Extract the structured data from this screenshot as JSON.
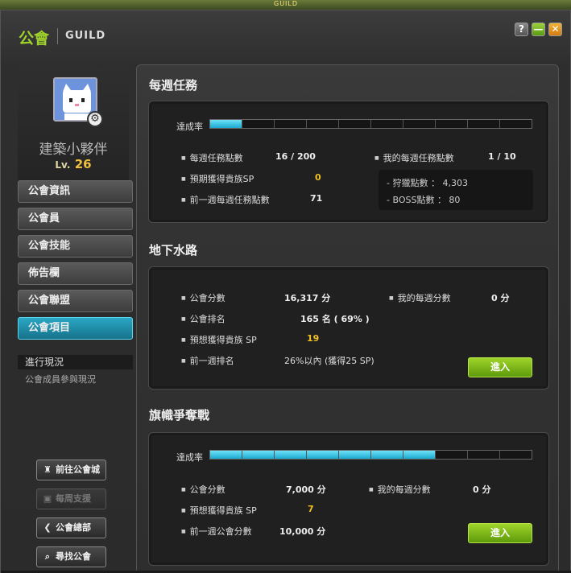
{
  "top_tag": "GUILD",
  "window": {
    "title_cn": "公會",
    "title_en": "GUILD",
    "help_label": "?",
    "min_label": "—",
    "close_label": "✕"
  },
  "profile": {
    "name": "建築小夥伴",
    "level_prefix": "Lv.",
    "level": "26"
  },
  "menu": [
    {
      "label": "公會資訊",
      "active": false
    },
    {
      "label": "公會員",
      "active": false
    },
    {
      "label": "公會技能",
      "active": false
    },
    {
      "label": "佈告欄",
      "active": false
    },
    {
      "label": "公會聯盟",
      "active": false
    },
    {
      "label": "公會項目",
      "active": true
    }
  ],
  "submenu": {
    "header": "進行現況",
    "item": "公會成員參與現況"
  },
  "side_buttons": [
    {
      "label": "前往公會城",
      "icon": "castle-icon",
      "enabled": true
    },
    {
      "label": "每周支援",
      "icon": "box-icon",
      "enabled": false
    },
    {
      "label": "公會總部",
      "icon": "back-arrow-icon",
      "enabled": true
    },
    {
      "label": "尋找公會",
      "icon": "search-icon",
      "enabled": true
    }
  ],
  "weekly": {
    "title": "每週任務",
    "progress_label": "達成率",
    "progress_segments": 10,
    "progress_filled": 1,
    "points_label": "每週任務點數",
    "points_value": "16 / 200",
    "my_points_label": "我的每週任務點數",
    "my_points_value": "1 / 10",
    "expected_sp_label": "預期獲得貴族SP",
    "expected_sp_value": "0",
    "last_week_label": "前一週每週任務點數",
    "last_week_value": "71",
    "hunting_label": "- 狩獵點數 ： 4,303",
    "boss_label": "- BOSS點數 ： 80"
  },
  "sewer": {
    "title": "地下水路",
    "score_label": "公會分數",
    "score_value": "16,317 分",
    "my_score_label": "我的每週分數",
    "my_score_value": "0 分",
    "rank_label": "公會排名",
    "rank_value": "165 名 ( 69% )",
    "expected_sp_label": "預想獲得貴族 SP",
    "expected_sp_value": "19",
    "last_week_label": "前一週排名",
    "last_week_value": "26%以內 (獲得25 SP)",
    "enter_label": "進入"
  },
  "flag": {
    "title": "旗幟爭奪戰",
    "progress_label": "達成率",
    "progress_segments": 10,
    "progress_filled": 7,
    "score_label": "公會分數",
    "score_value": "7,000 分",
    "my_score_label": "我的每週分數",
    "my_score_value": "0 分",
    "expected_sp_label": "預想獲得貴族 SP",
    "expected_sp_value": "7",
    "last_week_label": "前一週公會分數",
    "last_week_value": "10,000 分",
    "enter_label": "進入"
  },
  "colors": {
    "accent": "#9fd22b",
    "gold": "#f0c020",
    "menu_active": "#2aa7c4",
    "progress": "#1aa9cf",
    "enter": "#7cb81a"
  }
}
